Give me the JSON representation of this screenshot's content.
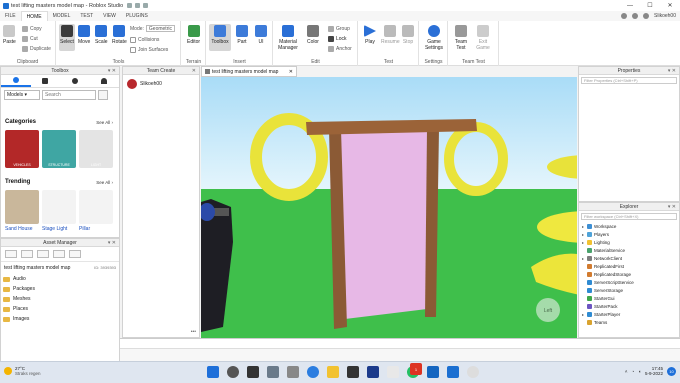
{
  "window": {
    "title": "test lifting masters model map - Roblox Studio"
  },
  "menu": {
    "items": [
      "FILE",
      "HOME",
      "MODEL",
      "TEST",
      "VIEW",
      "PLUGINS"
    ],
    "active": "HOME",
    "user": "Slikoeh00"
  },
  "ribbon": {
    "clipboard": {
      "label": "Clipboard",
      "paste": "Paste",
      "copy": "Copy",
      "cut": "Cut",
      "duplicate": "Duplicate"
    },
    "tools": {
      "label": "Tools",
      "select": "Select",
      "move": "Move",
      "scale": "Scale",
      "rotate": "Rotate",
      "mode_label": "Mode:",
      "mode_value": "Geometric",
      "collisions": "Collisions",
      "join_surfaces": "Join Surfaces"
    },
    "terrain": {
      "label": "Terrain",
      "editor": "Editor"
    },
    "insert": {
      "label": "Insert",
      "toolbox": "Toolbox",
      "part": "Part",
      "ui": "UI"
    },
    "edit": {
      "label": "Edit",
      "material": "Material Manager",
      "color": "Color",
      "group": "Group",
      "lock": "Lock",
      "anchor": "Anchor"
    },
    "test": {
      "label": "Test",
      "play": "Play",
      "resume": "Resume",
      "stop": "Stop"
    },
    "settings": {
      "label": "Settings",
      "game_settings": "Game Settings"
    },
    "team_test": {
      "label": "Team Test",
      "team_test": "Team Test",
      "exit_game": "Exit Game"
    }
  },
  "toolbox": {
    "title": "Toolbox",
    "dropdown": "Models",
    "search_placeholder": "Search",
    "categories_title": "Categories",
    "see_all": "See All",
    "categories": [
      "VEHICLES",
      "STRUCTURE",
      "LIGHT"
    ],
    "trending_title": "Trending",
    "trending": [
      "Sand House",
      "Stage Light",
      "Pillar"
    ]
  },
  "asset_manager": {
    "title": "Asset Manager",
    "place_name": "test lifting masters model map",
    "place_id": "ID: 3939393",
    "items": [
      "Audio",
      "Packages",
      "Meshes",
      "Places",
      "Images"
    ]
  },
  "team_create": {
    "title": "Team Create",
    "user": "Slikoeh00"
  },
  "viewport": {
    "tab": "test lifting masters model map",
    "badge": "Left"
  },
  "properties": {
    "title": "Properties",
    "filter": "Filter Properties (Ctrl+Shift+P)"
  },
  "explorer": {
    "title": "Explorer",
    "filter": "Filter workspace (Ctrl+Shift+X)",
    "items": [
      {
        "label": "Workspace",
        "color": "#3d8fd4",
        "arrow": "▸"
      },
      {
        "label": "Players",
        "color": "#4fa3d9",
        "arrow": "▸"
      },
      {
        "label": "Lighting",
        "color": "#f2c230",
        "arrow": "▸"
      },
      {
        "label": "MaterialService",
        "color": "#4aa36d",
        "arrow": ""
      },
      {
        "label": "NetworkClient",
        "color": "#7d7d7d",
        "arrow": "▸"
      },
      {
        "label": "ReplicatedFirst",
        "color": "#d27b2f",
        "arrow": ""
      },
      {
        "label": "ReplicatedStorage",
        "color": "#d27b2f",
        "arrow": ""
      },
      {
        "label": "ServerScriptService",
        "color": "#2f8bd2",
        "arrow": ""
      },
      {
        "label": "ServerStorage",
        "color": "#2f8bd2",
        "arrow": ""
      },
      {
        "label": "StarterGui",
        "color": "#3fa74a",
        "arrow": ""
      },
      {
        "label": "StarterPack",
        "color": "#6c55c2",
        "arrow": ""
      },
      {
        "label": "StarterPlayer",
        "color": "#2f8bd2",
        "arrow": "▸"
      },
      {
        "label": "Teams",
        "color": "#d9a32f",
        "arrow": ""
      }
    ]
  },
  "taskbar": {
    "temp": "27°C",
    "weather": "Straks regen",
    "time": "17:45",
    "date": "5-9-2022",
    "notif": "10",
    "badge_count": "1"
  }
}
